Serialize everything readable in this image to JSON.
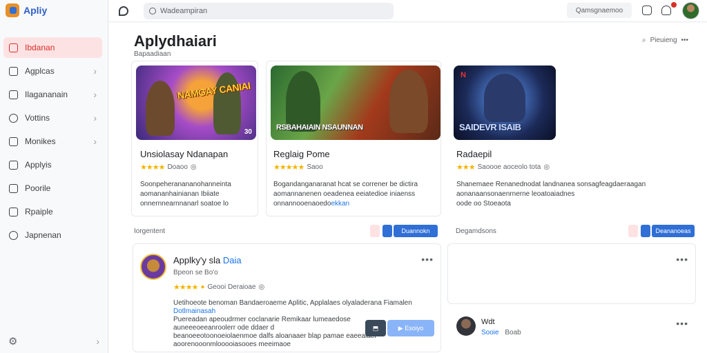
{
  "app": {
    "name": "Apliy"
  },
  "colors": {
    "accent": "#2f6fd6",
    "active_bg": "#fde2e4",
    "active_text": "#d93025",
    "star": "#f4b400",
    "link": "#1a73e8"
  },
  "sidebar": {
    "items": [
      {
        "label": "Ibdanan",
        "icon": "home-icon",
        "active": true
      },
      {
        "label": "Agplcas",
        "icon": "apps-icon",
        "chevron": true
      },
      {
        "label": "Ilagananain",
        "icon": "doc-icon",
        "chevron": true
      },
      {
        "label": "Vottins",
        "icon": "clock-icon",
        "chevron": true
      },
      {
        "label": "Monikes",
        "icon": "mail-icon",
        "chevron": true
      },
      {
        "label": "Applyis",
        "icon": "list-icon"
      },
      {
        "label": "Poorile",
        "icon": "file-icon"
      },
      {
        "label": "Rpaiple",
        "icon": "flag-icon"
      },
      {
        "label": "Japnenan",
        "icon": "cloud-icon"
      }
    ]
  },
  "topbar": {
    "search_placeholder": "Wadeampiran",
    "button_label": "Qamsgnaemoo"
  },
  "page": {
    "title": "Aplydhaiari",
    "subtitle": "Bapaadiaan",
    "action_label": "Pieuieng"
  },
  "cards": [
    {
      "thumb_text": "NAMGAY CANIAI",
      "badge": "30",
      "title": "Unsiolasay Ndanapan",
      "stars": "★★★★",
      "rating_text": "Doaoo",
      "desc_lines": [
        "Soonpeheranananohanneinta",
        "aomananhainianan Ibiiate",
        "onnernnearnnanarl soatoe"
      ],
      "desc_link": "lo"
    },
    {
      "thumb_text": "RSBAHAIAIN  NSAUNNAN",
      "title": "Reglaig Pome",
      "stars": "★★★★★",
      "rating_text": "Saoo",
      "desc_lines": [
        "Bogandanganaranat hcat se correner be dictira",
        "aomannanenen oeadenea eeiatedioe iniaenss",
        "onnannooenaoedo"
      ],
      "desc_link": "ekkan"
    },
    {
      "thumb_text": "SAIDEVR  ISAIB",
      "title": "Radaepil",
      "stars": "★★★",
      "rating_text": "Saoooe aoceolo tota",
      "desc_lines": [
        "Shanemaee Renanednodat landnanea sonsagfeagdaeraagan",
        "aonanaansonaenrnerne leoatoaiadnes",
        "oode oo Stoeaota"
      ],
      "desc_link": "Stoeaota"
    }
  ],
  "strips": [
    {
      "label": "Iorgentent",
      "button": "Duannokn"
    },
    {
      "label": "Degamdsons",
      "button": "Deananoeas"
    }
  ],
  "app_card": {
    "title": "Applky'y sla",
    "title_link": "Daia",
    "subtitle": "Bpeon se  Bo'o",
    "stars": "★★★★",
    "rating_text": "Geooi Deraioae",
    "lines": [
      "Uetihoeote benoman Bandaeroaeme Aplitic, Applalaes olyaladerana Fiamalen",
      "Dotlmainasah",
      "Puereadan apeoudrmer coclanarie Remikaar lumeaedose",
      "auneeeoeeanroolerr ode ddaer d",
      "beanoeeotoonoeiolaenmoe dalfs aloanaaer blap pamae eaeeaiaer",
      "aoorenooonmlooooiasooes meeimaoe"
    ],
    "play_label": "Esoiyo"
  },
  "user_card": {
    "name": "Wdt",
    "subtitle": "Sooie",
    "link": "Sooie",
    "meta": "Boab"
  }
}
